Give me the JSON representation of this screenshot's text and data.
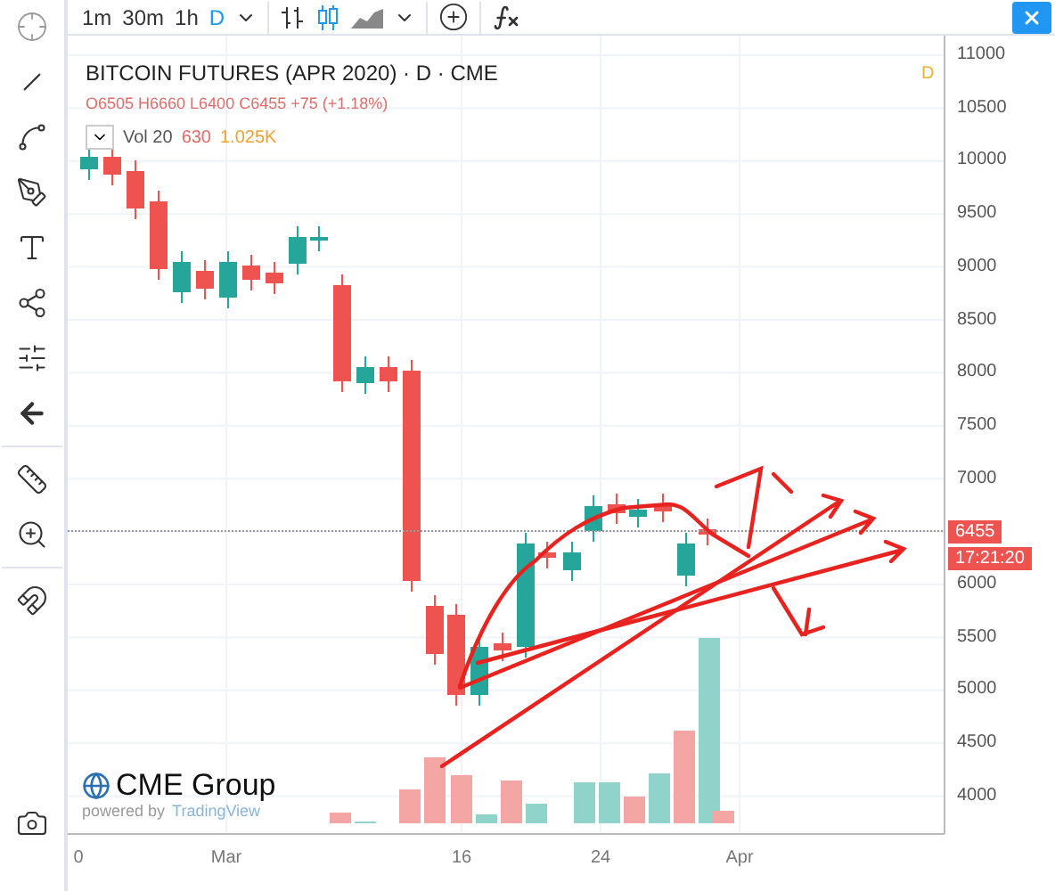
{
  "toolbar": {
    "timeframes": [
      {
        "label": "1m",
        "selected": false
      },
      {
        "label": "30m",
        "selected": false
      },
      {
        "label": "1h",
        "selected": false
      },
      {
        "label": "D",
        "selected": true
      }
    ]
  },
  "legend": {
    "title": "BITCOIN FUTURES (APR 2020) · D · CME",
    "ohlc": "O6505 H6660 L6400 C6455 +75 (+1.18%)",
    "volume": {
      "name": "Vol 20",
      "value": "630",
      "average": "1.025K"
    },
    "flag": "D"
  },
  "price_axis": {
    "labels": [
      "11000",
      "10500",
      "10000",
      "9500",
      "9000",
      "8500",
      "8000",
      "7500",
      "7000",
      "6000",
      "5500",
      "5000",
      "4500",
      "4000"
    ],
    "last_price": "6455",
    "countdown": "17:21:20"
  },
  "time_axis": {
    "labels": [
      "0",
      "Mar",
      "16",
      "24",
      "Apr"
    ]
  },
  "logo": {
    "name": "CME Group",
    "powered_by": "powered by",
    "platform": "TradingView"
  }
}
